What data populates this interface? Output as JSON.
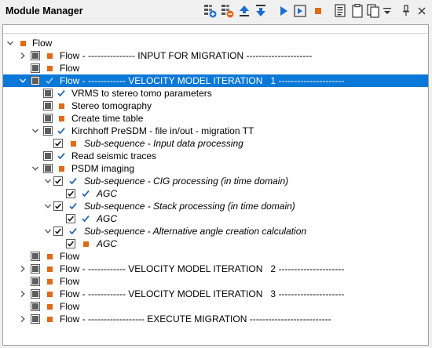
{
  "panel": {
    "title": "Module Manager"
  },
  "toolbar": [
    {
      "name": "add-module-icon"
    },
    {
      "name": "remove-module-icon"
    },
    {
      "name": "move-up-icon"
    },
    {
      "name": "move-down-icon"
    },
    {
      "name": "run-icon"
    },
    {
      "name": "run-step-icon"
    },
    {
      "name": "stop-icon"
    },
    {
      "name": "log-icon"
    },
    {
      "name": "clipboard-icon"
    },
    {
      "name": "copy-icon"
    },
    {
      "name": "dropdown-icon"
    },
    {
      "name": "pin-icon"
    },
    {
      "name": "close-icon"
    }
  ],
  "tree": {
    "rows": [
      {
        "label": "Flow"
      },
      {
        "label": "Flow - --------------- INPUT FOR MIGRATION ---------------------"
      },
      {
        "label": "Flow"
      },
      {
        "label": "Flow - ------------ VELOCITY MODEL ITERATION   1 ---------------------"
      },
      {
        "label": "VRMS to stereo tomo parameters"
      },
      {
        "label": "Stereo tomography"
      },
      {
        "label": "Create time table"
      },
      {
        "label": "Kirchhoff PreSDM - file in/out - migration TT"
      },
      {
        "label": "Sub-sequence - Input data processing"
      },
      {
        "label": "Read seismic traces"
      },
      {
        "label": "PSDM imaging"
      },
      {
        "label": "Sub-sequence - CIG processing (in time domain)"
      },
      {
        "label": "AGC"
      },
      {
        "label": "Sub-sequence - Stack processing (in time domain)"
      },
      {
        "label": "AGC"
      },
      {
        "label": "Sub-sequence - Alternative angle creation calculation"
      },
      {
        "label": "AGC"
      },
      {
        "label": "Flow"
      },
      {
        "label": "Flow - ------------ VELOCITY MODEL ITERATION   2 ---------------------"
      },
      {
        "label": "Flow"
      },
      {
        "label": "Flow - ------------ VELOCITY MODEL ITERATION   3 ---------------------"
      },
      {
        "label": "Flow"
      },
      {
        "label": "Flow - ------------------ EXECUTE MIGRATION --------------------------"
      }
    ]
  },
  "colors": {
    "selection": "#0a78d7",
    "module_orange": "#e06a18",
    "check_blue": "#1a5fb4"
  }
}
